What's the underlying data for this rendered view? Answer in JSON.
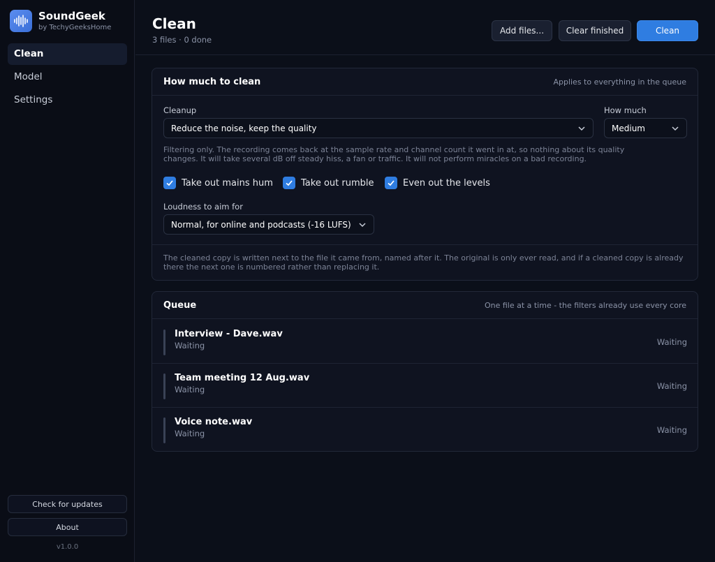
{
  "sidebar": {
    "app_name": "SoundGeek",
    "app_subtitle": "by TechyGeeksHome",
    "nav": [
      {
        "label": "Clean"
      },
      {
        "label": "Model"
      },
      {
        "label": "Settings"
      }
    ],
    "check_updates_label": "Check for updates",
    "about_label": "About",
    "version": "v1.0.0"
  },
  "header": {
    "title": "Clean",
    "subtitle": "3 files · 0 done",
    "add_files_label": "Add files...",
    "clear_finished_label": "Clear finished",
    "clean_label": "Clean"
  },
  "settings_panel": {
    "title": "How much to clean",
    "hint": "Applies to everything in the queue",
    "cleanup_label": "Cleanup",
    "cleanup_value": "Reduce the noise, keep the quality",
    "how_much_label": "How much",
    "how_much_value": "Medium",
    "cleanup_note_line1": "Filtering only. The recording comes back at the sample rate and channel count it went in at, so nothing about its quality",
    "cleanup_note_line2": "changes. It will take several dB off steady hiss, a fan or traffic. It will not perform miracles on a bad recording.",
    "checkboxes": [
      {
        "label": "Take out mains hum",
        "checked": true
      },
      {
        "label": "Take out rumble",
        "checked": true
      },
      {
        "label": "Even out the levels",
        "checked": true
      }
    ],
    "loudness_label": "Loudness to aim for",
    "loudness_value": "Normal, for online and podcasts (-16 LUFS)",
    "footer_note_line1": "The cleaned copy is written next to the file it came from, named after it. The original is only ever read, and if a cleaned copy is already",
    "footer_note_line2": "there the next one is numbered rather than replacing it."
  },
  "queue_panel": {
    "title": "Queue",
    "hint": "One file at a time - the filters already use every core",
    "items": [
      {
        "name": "Interview - Dave.wav",
        "sub": "Waiting",
        "status": "Waiting"
      },
      {
        "name": "Team meeting 12 Aug.wav",
        "sub": "Waiting",
        "status": "Waiting"
      },
      {
        "name": "Voice note.wav",
        "sub": "Waiting",
        "status": "Waiting"
      }
    ]
  },
  "colors": {
    "accent": "#2f7de1",
    "background": "#0b0f19",
    "panel": "#0f1320"
  },
  "icons": {
    "logo": "waveform-icon",
    "dropdown": "chevron-down-icon",
    "checkbox": "checkmark-icon"
  }
}
